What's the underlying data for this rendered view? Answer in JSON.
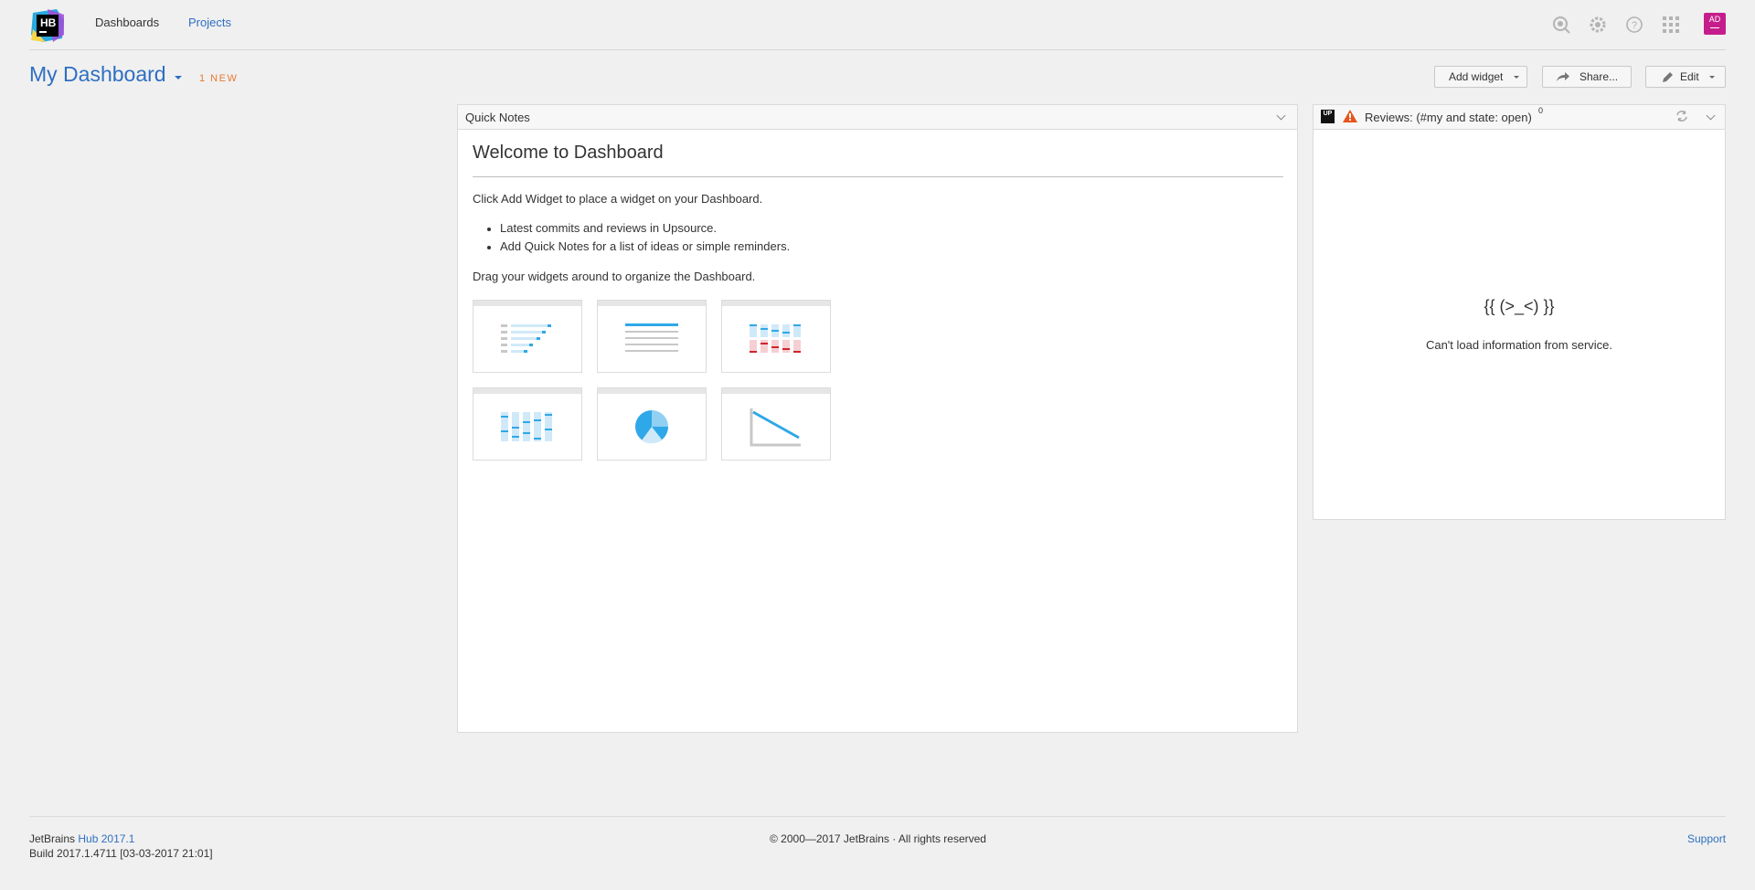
{
  "header": {
    "logo_text": "HB",
    "nav": [
      {
        "label": "Dashboards"
      },
      {
        "label": "Projects"
      }
    ],
    "avatar_initials": "AD",
    "icons": [
      "search-icon",
      "gear-icon",
      "help-icon",
      "apps-grid-icon"
    ]
  },
  "dashboard": {
    "title": "My Dashboard",
    "new_badge": "1 NEW",
    "buttons": {
      "add_widget": "Add widget",
      "share": "Share...",
      "edit": "Edit"
    }
  },
  "quick_notes": {
    "title": "Quick Notes",
    "heading": "Welcome to Dashboard",
    "intro": "Click Add Widget to place a widget on your Dashboard.",
    "bullets": [
      "Latest commits and reviews in Upsource.",
      "Add Quick Notes for a list of ideas or simple reminders."
    ],
    "outro": "Drag your widgets around to organize the Dashboard.",
    "thumbnails": [
      "tree-list-icon",
      "text-lines-icon",
      "bar-chart-icon",
      "column-chart-icon",
      "pie-chart-icon",
      "line-chart-icon"
    ]
  },
  "reviews": {
    "badge": "UP",
    "title": "Reviews: (#my and state: open)",
    "count": "0",
    "error_face": "{{ (>_<) }}",
    "error_text": "Can't load information from service."
  },
  "footer": {
    "brand": "JetBrains",
    "product": "Hub 2017.1",
    "build": "Build 2017.1.4711 [03-03-2017 21:01]",
    "copyright": "© 2000—2017 JetBrains · All rights reserved",
    "support": "Support"
  },
  "colors": {
    "accent": "#2e6fc2",
    "badge": "#e9782f",
    "avatar": "#c51e8c",
    "warning": "#e8541c"
  }
}
